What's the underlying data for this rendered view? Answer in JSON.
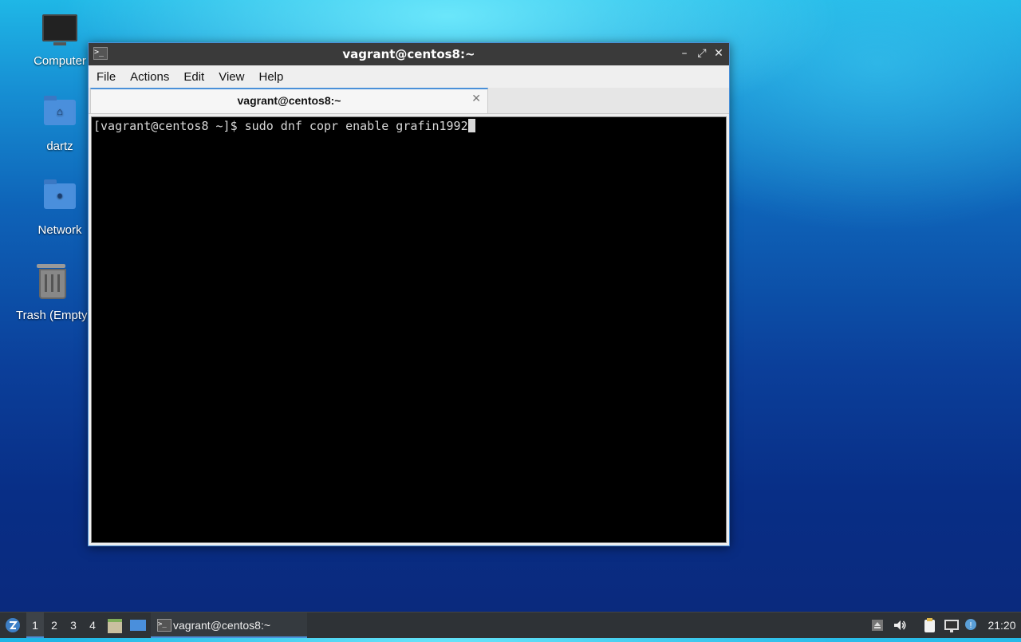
{
  "desktop": {
    "icons": [
      {
        "label": "Computer"
      },
      {
        "label": "dartz"
      },
      {
        "label": "Network"
      },
      {
        "label": "Trash (Empty)"
      }
    ]
  },
  "window": {
    "title": "vagrant@centos8:~",
    "buttons": {
      "minimize": "–",
      "maximize": "⤢",
      "close": "✕"
    },
    "menu": [
      "File",
      "Actions",
      "Edit",
      "View",
      "Help"
    ],
    "tab": {
      "label": "vagrant@centos8:~",
      "close": "✕"
    },
    "terminal": {
      "line": "[vagrant@centos8 ~]$ sudo dnf copr enable grafin1992"
    }
  },
  "taskbar": {
    "workspaces": [
      "1",
      "2",
      "3",
      "4"
    ],
    "active_workspace": "1",
    "task_title": "vagrant@centos8:~",
    "clock": "21:20"
  },
  "colors": {
    "accent": "#4a90d9",
    "titlebar": "#3a3a3a",
    "terminal_bg": "#000000",
    "terminal_fg": "#d8d8d8",
    "taskbar": "#2e3236"
  }
}
